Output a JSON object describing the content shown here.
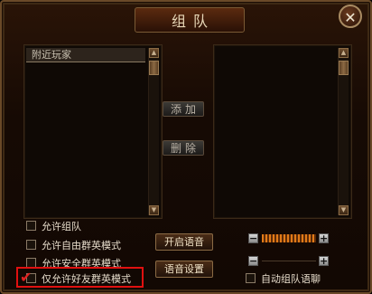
{
  "window": {
    "title": "组队",
    "close_label": "✕"
  },
  "nearby_list": {
    "header": "附近玩家"
  },
  "buttons": {
    "add": "添加",
    "delete": "删除",
    "voice_on": "开启语音",
    "voice_settings": "语音设置"
  },
  "options": [
    {
      "label": "允许组队",
      "checked": false
    },
    {
      "label": "允许自由群英模式",
      "checked": false
    },
    {
      "label": "允许安全群英模式",
      "checked": false
    },
    {
      "label": "仅允许好友群英模式",
      "checked": true
    }
  ],
  "auto_team_chat": {
    "label": "自动组队语聊",
    "checked": false
  },
  "volume": {
    "minus": "−",
    "plus": "+"
  },
  "colors": {
    "highlight": "#e01010",
    "volume": "#e07a18"
  }
}
